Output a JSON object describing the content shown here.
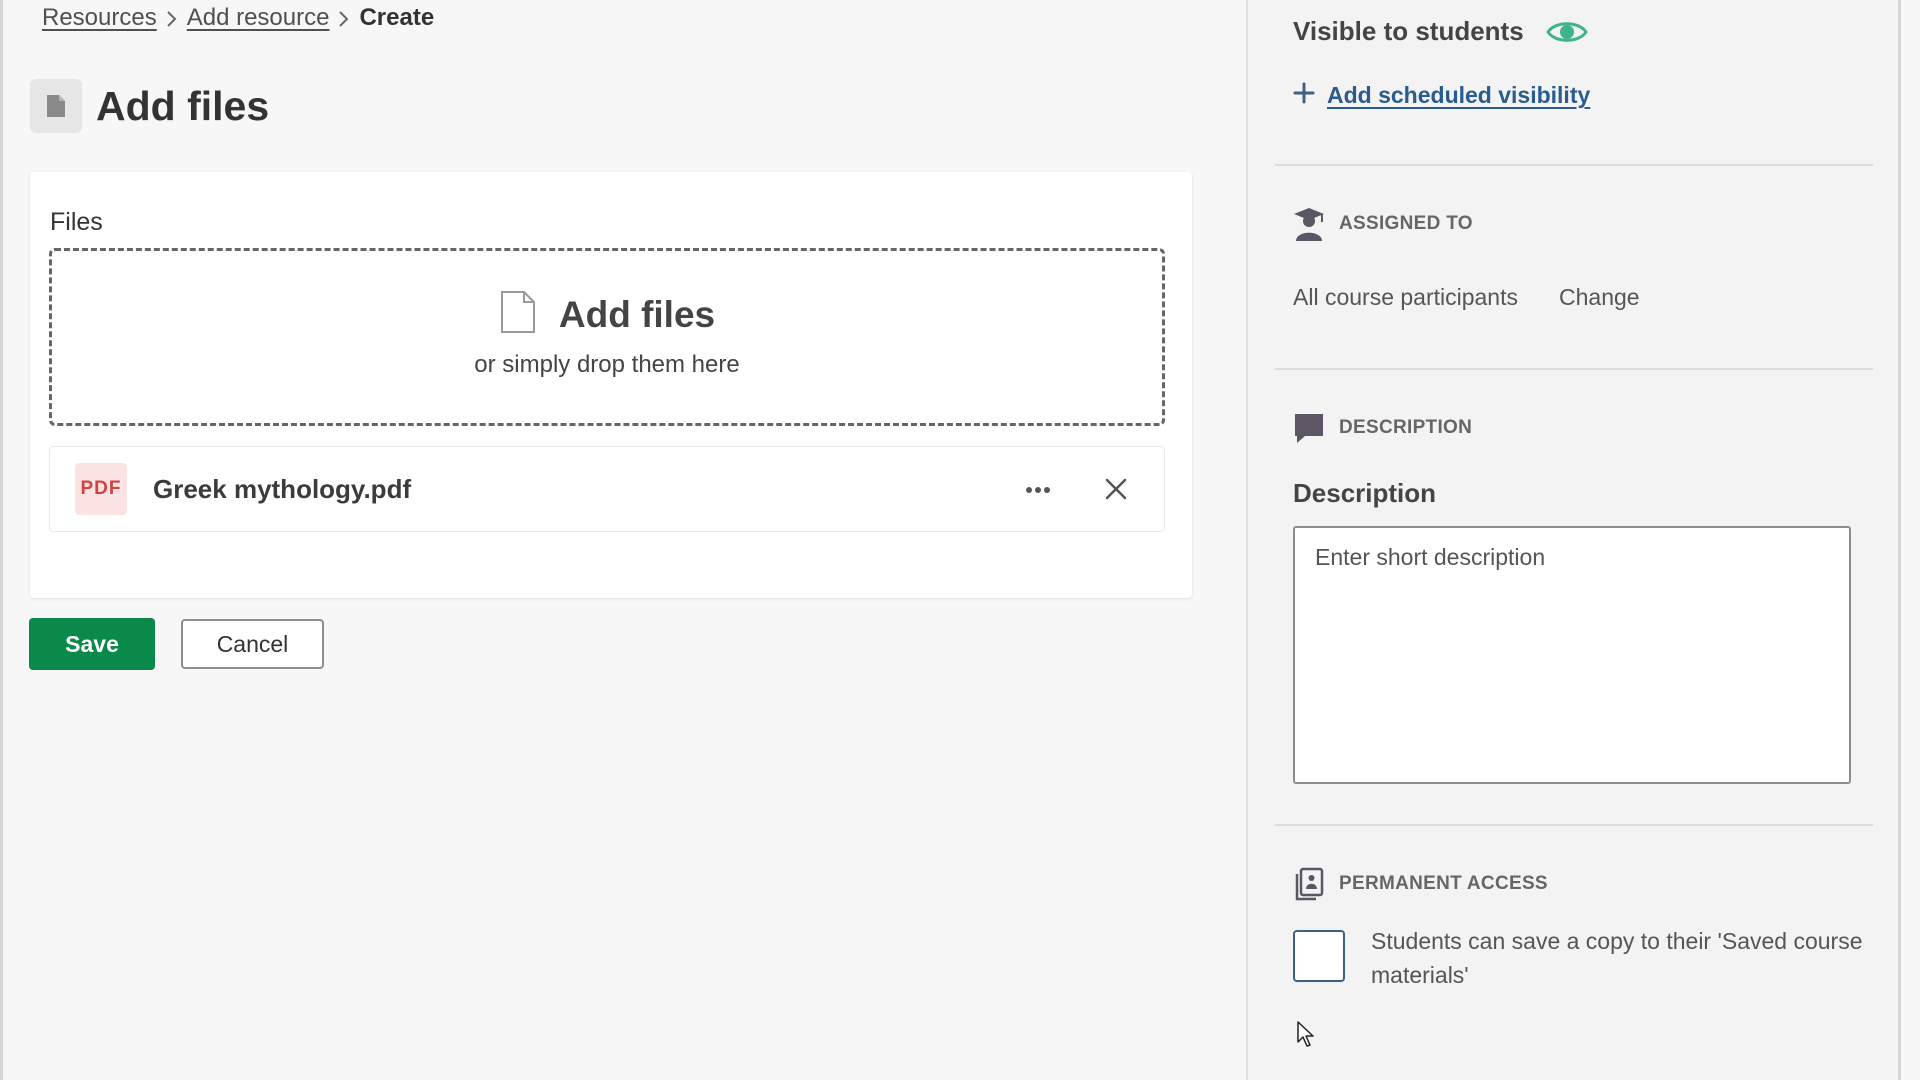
{
  "breadcrumb": {
    "items": [
      "Resources",
      "Add resource"
    ],
    "current": "Create"
  },
  "page": {
    "title": "Add files"
  },
  "files": {
    "label": "Files",
    "dropzone_title": "Add files",
    "dropzone_subtitle": "or simply drop them here",
    "items": [
      {
        "badge": "PDF",
        "name": "Greek mythology.pdf"
      }
    ]
  },
  "actions": {
    "save": "Save",
    "cancel": "Cancel"
  },
  "sidebar": {
    "visibility": "Visible to students",
    "add_scheduled": "Add scheduled visibility",
    "assigned": {
      "heading": "ASSIGNED TO",
      "value": "All course participants",
      "change": "Change"
    },
    "description": {
      "heading": "DESCRIPTION",
      "label": "Description",
      "placeholder": "Enter short description"
    },
    "permanent": {
      "heading": "PERMANENT ACCESS",
      "checkbox_label": "Students can save a copy to their 'Saved course materials'",
      "checked": false
    }
  },
  "colors": {
    "save_button": "#0a8a4a",
    "eye_icon": "#3fb38d",
    "link": "#2a5c8f",
    "section_icon": "#5b5663",
    "pdf_badge_text": "#d14343"
  }
}
